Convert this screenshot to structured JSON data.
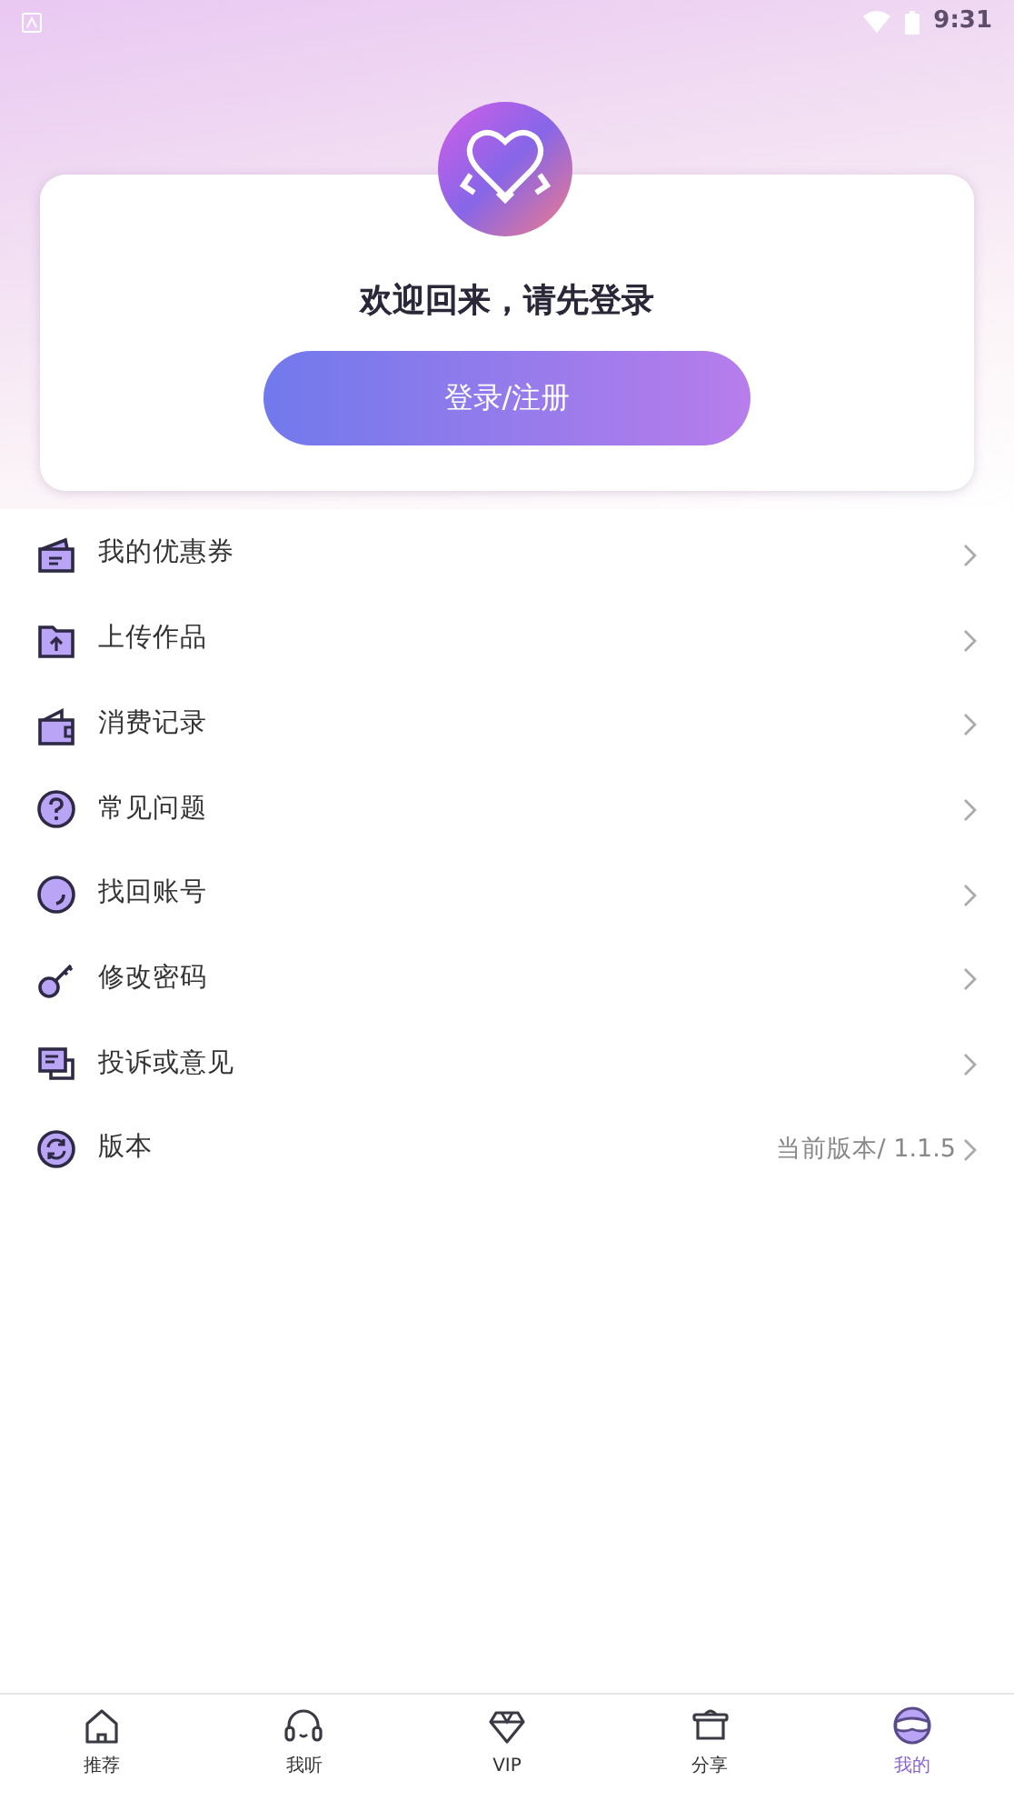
{
  "status_bar": {
    "time": "9:31"
  },
  "login_card": {
    "title": "欢迎回来，请先登录",
    "button": "登录/注册"
  },
  "menu": [
    {
      "kind": "coupon",
      "label": "我的优惠券"
    },
    {
      "kind": "upload",
      "label": "上传作品"
    },
    {
      "kind": "wallet",
      "label": "消费记录"
    },
    {
      "kind": "help",
      "label": "常见问题"
    },
    {
      "kind": "recover",
      "label": "找回账号"
    },
    {
      "kind": "key",
      "label": "修改密码"
    },
    {
      "kind": "feedback",
      "label": "投诉或意见"
    },
    {
      "kind": "version",
      "label": "版本",
      "value": "当前版本/ 1.1.5"
    }
  ],
  "tab_bar": [
    {
      "kind": "home",
      "label": "推荐",
      "selected": false
    },
    {
      "kind": "listen",
      "label": "我听",
      "selected": false
    },
    {
      "kind": "vip",
      "label": "VIP",
      "selected": false
    },
    {
      "kind": "share",
      "label": "分享",
      "selected": false
    },
    {
      "kind": "mine",
      "label": "我的",
      "selected": true
    }
  ]
}
